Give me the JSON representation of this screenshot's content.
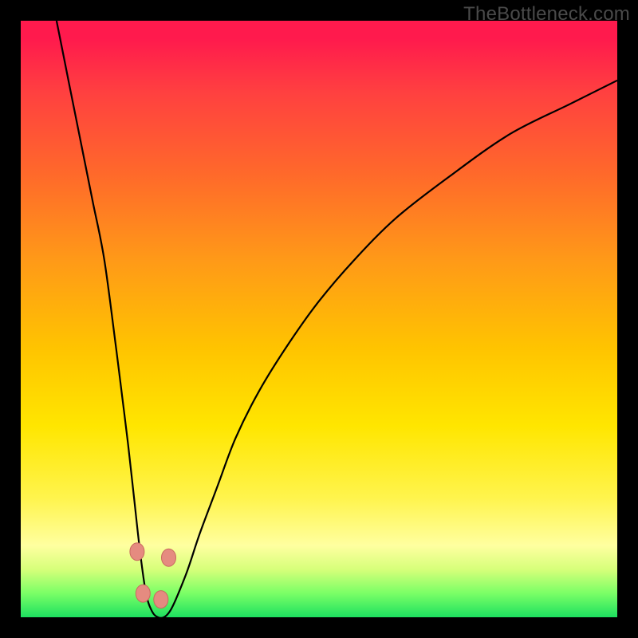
{
  "watermark": "TheBottleneck.com",
  "colors": {
    "page_bg": "#000000",
    "curve_stroke": "#000000",
    "marker_fill": "#e58b80",
    "marker_stroke": "#c96a5f"
  },
  "chart_data": {
    "type": "line",
    "title": "",
    "xlabel": "",
    "ylabel": "",
    "xlim": [
      0,
      100
    ],
    "ylim": [
      0,
      100
    ],
    "series": [
      {
        "name": "bottleneck-curve",
        "x": [
          6,
          8,
          10,
          12,
          14,
          16,
          17,
          18,
          19,
          20,
          21,
          22,
          23,
          24,
          25,
          26,
          28,
          30,
          33,
          36,
          40,
          45,
          50,
          56,
          63,
          72,
          82,
          92,
          100
        ],
        "values": [
          100,
          90,
          80,
          70,
          60,
          45,
          37,
          29,
          20,
          11,
          4,
          1,
          0,
          0,
          1,
          3,
          8,
          14,
          22,
          30,
          38,
          46,
          53,
          60,
          67,
          74,
          81,
          86,
          90
        ]
      }
    ],
    "markers": [
      {
        "x": 19.5,
        "y": 11
      },
      {
        "x": 20.5,
        "y": 4
      },
      {
        "x": 23.5,
        "y": 3
      },
      {
        "x": 24.8,
        "y": 10
      }
    ]
  }
}
